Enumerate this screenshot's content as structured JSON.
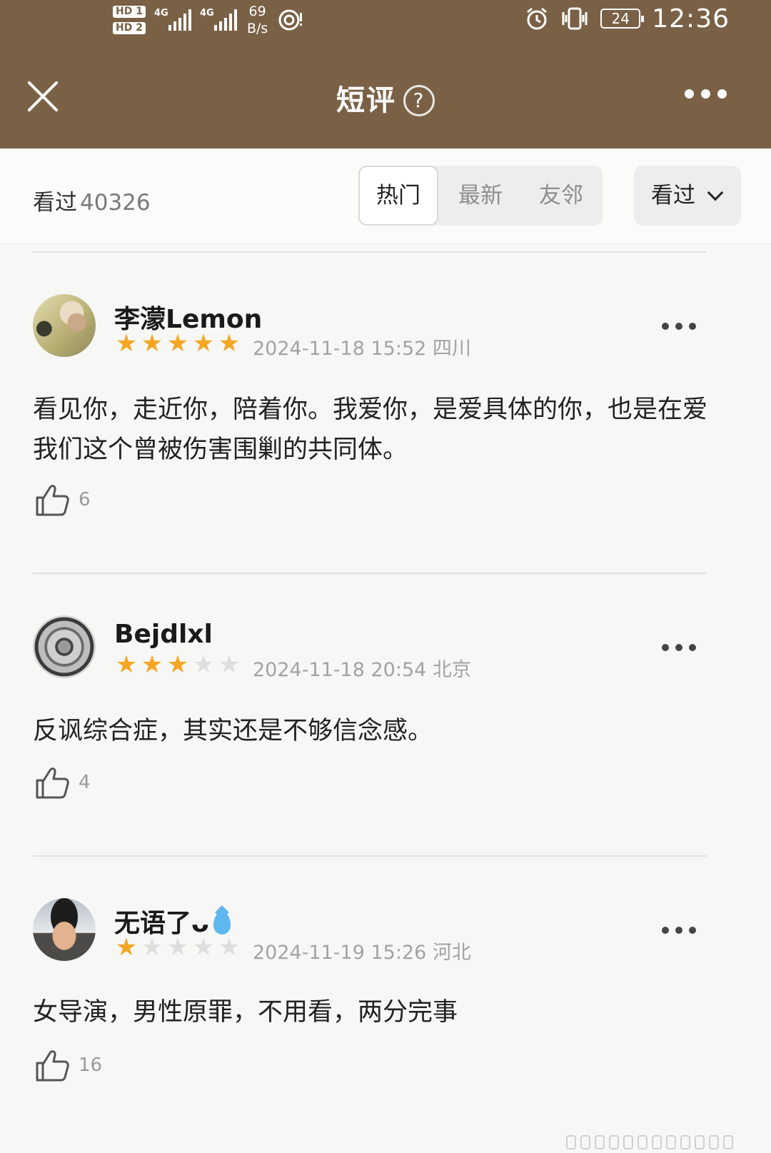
{
  "status_bar": {
    "hd1": "HD 1",
    "hd2": "HD 2",
    "sig1_tag": "4G",
    "sig2_tag": "4G",
    "speed_value": "69",
    "speed_unit": "B/s",
    "battery": "24",
    "time": "12:36"
  },
  "header": {
    "title": "短评",
    "help_icon": "?",
    "more_icon": "more-horizontal"
  },
  "filter": {
    "count_label": "看过",
    "count_value": "40326",
    "tabs": [
      {
        "label": "热门",
        "active": true
      },
      {
        "label": "最新",
        "active": false
      },
      {
        "label": "友邻",
        "active": false
      }
    ],
    "status_dropdown": "看过"
  },
  "reviews": [
    {
      "username": "李濛Lemon",
      "rating": 5,
      "meta": "2024-11-18 15:52 四川",
      "content": "看见你，走近你，陪着你。我爱你，是爱具体的你，也是在爱我们这个曾被伤害围剿的共同体。",
      "likes": "6"
    },
    {
      "username": "Bejdlxl",
      "rating": 3,
      "meta": "2024-11-18 20:54 北京",
      "content": "反讽综合症，其实还是不够信念感。",
      "likes": "4"
    },
    {
      "username": "无语了",
      "username_suffix": "ᴗ",
      "rating": 1,
      "meta": "2024-11-19 15:26 河北",
      "content": "女导演，男性原罪，不用看，两分完事",
      "likes": "16"
    }
  ],
  "colors": {
    "header_bg": "#7a6146",
    "star_on": "#f5a623",
    "star_off": "#dedede",
    "page_bg": "#f7f7f5"
  }
}
